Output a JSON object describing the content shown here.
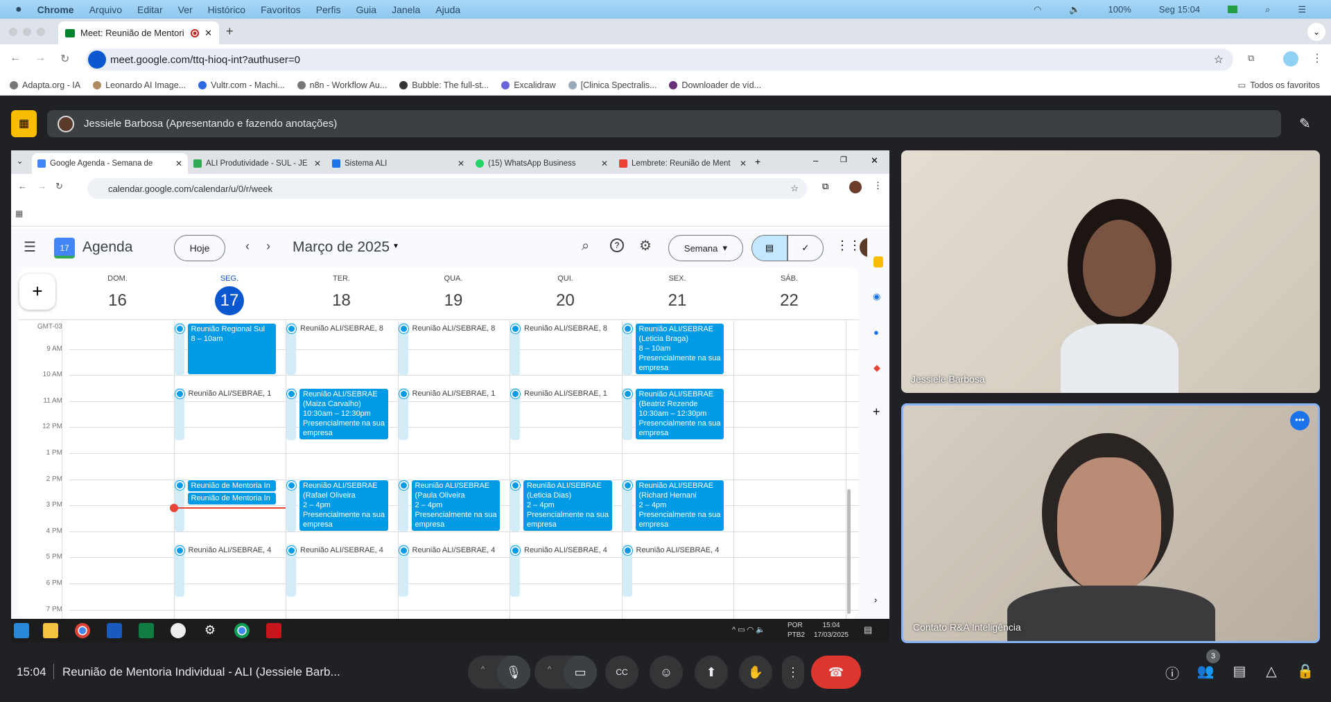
{
  "mac_menu": {
    "apple": "",
    "items": [
      "Chrome",
      "Arquivo",
      "Editar",
      "Ver",
      "Histórico",
      "Favoritos",
      "Perfis",
      "Guia",
      "Janela",
      "Ajuda"
    ],
    "battery": "100%",
    "clock": "Seg 15:04"
  },
  "browser": {
    "tab_title": "Meet: Reunião de Mentori",
    "url": "meet.google.com/ttq-hioq-int?authuser=0",
    "new_tab": "+",
    "bookmarks": [
      "Adapta.org - IA",
      "Leonardo AI Image...",
      "Vultr.com - Machi...",
      "n8n - Workflow Au...",
      "Bubble: The full-st...",
      "Excalidraw",
      "[Clinica Spectralis...",
      "Downloader de víd..."
    ],
    "all_bookmarks": "Todos os favoritos"
  },
  "meet": {
    "presenter": "Jessiele Barbosa (Apresentando e fazendo anotações)",
    "time": "15:04",
    "meeting_title": "Reunião de Mentoria Individual - ALI (Jessiele Barb...",
    "participants_count": "3",
    "tiles": [
      {
        "name": "Jessiele Barbosa"
      },
      {
        "name": "Contato R&A Inteligência"
      }
    ]
  },
  "shared": {
    "tabs": [
      "Google Agenda - Semana de",
      "ALI Produtividade - SUL - JE",
      "Sistema ALI",
      "(15) WhatsApp Business",
      "Lembrete: Reunião de Ment"
    ],
    "url": "calendar.google.com/calendar/u/0/r/week",
    "calendar": {
      "app_name": "Agenda",
      "logo_num": "17",
      "today_btn": "Hoje",
      "month": "Março de 2025",
      "view": "Semana",
      "timezone": "GMT-03",
      "days": [
        {
          "name": "DOM.",
          "num": "16"
        },
        {
          "name": "SEG.",
          "num": "17",
          "today": true
        },
        {
          "name": "TER.",
          "num": "18"
        },
        {
          "name": "QUA.",
          "num": "19"
        },
        {
          "name": "QUI.",
          "num": "20"
        },
        {
          "name": "SEX.",
          "num": "21"
        },
        {
          "name": "SÁB.",
          "num": "22"
        }
      ],
      "hours": [
        "9 AM",
        "10 AM",
        "11 AM",
        "12 PM",
        "1 PM",
        "2 PM",
        "3 PM",
        "4 PM",
        "5 PM",
        "6 PM",
        "7 PM"
      ],
      "now": {
        "day": 1,
        "hour": 15.07
      },
      "pale_events": [
        {
          "day": 1,
          "start": 8,
          "end": 10,
          "title": ""
        },
        {
          "day": 2,
          "start": 8,
          "end": 10,
          "title": "Reunião ALI/SEBRAE, 8"
        },
        {
          "day": 3,
          "start": 8,
          "end": 10,
          "title": "Reunião ALI/SEBRAE, 8"
        },
        {
          "day": 4,
          "start": 8,
          "end": 10,
          "title": "Reunião ALI/SEBRAE, 8"
        },
        {
          "day": 5,
          "start": 8,
          "end": 10,
          "title": ""
        },
        {
          "day": 1,
          "start": 10.5,
          "end": 12.5,
          "title": "Reunião ALI/SEBRAE, 1"
        },
        {
          "day": 2,
          "start": 10.5,
          "end": 12.5,
          "title": ""
        },
        {
          "day": 3,
          "start": 10.5,
          "end": 12.5,
          "title": "Reunião ALI/SEBRAE, 1"
        },
        {
          "day": 4,
          "start": 10.5,
          "end": 12.5,
          "title": "Reunião ALI/SEBRAE, 1"
        },
        {
          "day": 5,
          "start": 10.5,
          "end": 12.5,
          "title": ""
        },
        {
          "day": 1,
          "start": 14,
          "end": 16,
          "title": ""
        },
        {
          "day": 2,
          "start": 14,
          "end": 16,
          "title": ""
        },
        {
          "day": 3,
          "start": 14,
          "end": 16,
          "title": ""
        },
        {
          "day": 4,
          "start": 14,
          "end": 16,
          "title": ""
        },
        {
          "day": 5,
          "start": 14,
          "end": 16,
          "title": ""
        },
        {
          "day": 1,
          "start": 16.5,
          "end": 18.5,
          "title": "Reunião ALI/SEBRAE, 4"
        },
        {
          "day": 2,
          "start": 16.5,
          "end": 18.5,
          "title": "Reunião ALI/SEBRAE, 4"
        },
        {
          "day": 3,
          "start": 16.5,
          "end": 18.5,
          "title": "Reunião ALI/SEBRAE, 4"
        },
        {
          "day": 4,
          "start": 16.5,
          "end": 18.5,
          "title": "Reunião ALI/SEBRAE, 4"
        },
        {
          "day": 5,
          "start": 16.5,
          "end": 18.5,
          "title": "Reunião ALI/SEBRAE, 4"
        }
      ],
      "events": [
        {
          "day": 1,
          "start": 8,
          "end": 10,
          "lines": [
            "Reunião Regional Sul",
            "8 – 10am"
          ]
        },
        {
          "day": 5,
          "start": 8,
          "end": 10,
          "lines": [
            "Reunião ALI/SEBRAE",
            "(Leticia Braga)",
            "8 – 10am",
            "Presencialmente na sua",
            "empresa"
          ]
        },
        {
          "day": 2,
          "start": 10.5,
          "end": 12.5,
          "lines": [
            "Reunião ALI/SEBRAE",
            "(Maiza Carvalho)",
            "10:30am – 12:30pm",
            "Presencialmente na sua",
            "empresa"
          ]
        },
        {
          "day": 5,
          "start": 10.5,
          "end": 12.5,
          "lines": [
            "Reunião ALI/SEBRAE",
            "(Beatriz Rezende",
            "10:30am – 12:30pm",
            "Presencialmente na sua",
            "empresa"
          ]
        },
        {
          "day": 1,
          "start": 14,
          "end": 14.5,
          "lines": [
            "Reunião de Mentoria In"
          ]
        },
        {
          "day": 1,
          "start": 14.5,
          "end": 15,
          "lines": [
            "Reunião de Mentoria In"
          ]
        },
        {
          "day": 2,
          "start": 14,
          "end": 16,
          "lines": [
            "Reunião ALI/SEBRAE",
            "(Rafael Oliveira",
            "2 – 4pm",
            "Presencialmente na sua",
            "empresa"
          ]
        },
        {
          "day": 3,
          "start": 14,
          "end": 16,
          "lines": [
            "Reunião ALI/SEBRAE",
            "(Paula Oliveira",
            "2 – 4pm",
            "Presencialmente na sua",
            "empresa"
          ]
        },
        {
          "day": 4,
          "start": 14,
          "end": 16,
          "lines": [
            "Reunião ALI/SEBRAE",
            "(Leticia Dias)",
            "2 – 4pm",
            "Presencialmente na sua",
            "empresa"
          ]
        },
        {
          "day": 5,
          "start": 14,
          "end": 16,
          "lines": [
            "Reunião ALI/SEBRAE",
            "(Richard Hernani",
            "2 – 4pm",
            "Presencialmente na sua",
            "empresa"
          ]
        }
      ]
    },
    "taskbar": {
      "lang1": "POR",
      "lang2": "PTB2",
      "time": "15:04",
      "date": "17/03/2025"
    }
  },
  "colors": {
    "event": "#039be5",
    "today": "#0b57d0",
    "hangup": "#dc362e",
    "now_line": "#ea4335",
    "present_badge": "#fbbc04"
  }
}
